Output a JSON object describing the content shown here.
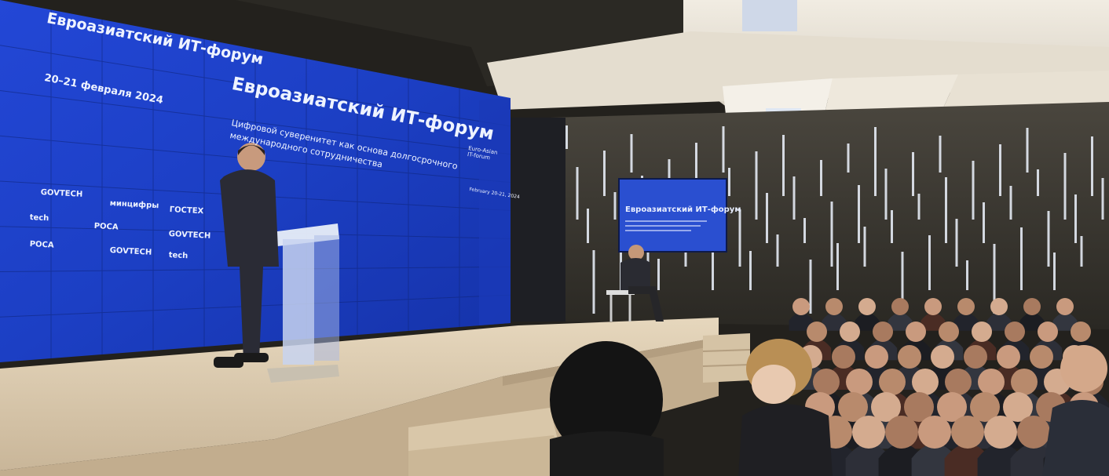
{
  "screen": {
    "left_title": "Евроазиатский ИТ-форум",
    "left_dates": "20–21 февраля 2024",
    "main_title": "Евроазиатский ИТ-форум",
    "subtitle_line1": "Цифровой суверенитет как основа долгосрочного",
    "subtitle_line2": "международного сотрудничества",
    "side_title": "Euro-Asian IT-forum",
    "side_dates": "February 20-21, 2024",
    "logos": [
      "GOVTECH",
      "минцифры",
      "ГОСТЕХ",
      "tech",
      "РОСА",
      "GOVTECH",
      "РОСА",
      "GOVTECH",
      "tech"
    ]
  },
  "monitor": {
    "title": "Евроазиатский ИТ-форум"
  },
  "colors": {
    "screen_blue": "#1b3fc9",
    "stage_floor": "#d8c7ad",
    "wall_dark": "#3a3730",
    "ceiling": "#e9e3d7"
  }
}
